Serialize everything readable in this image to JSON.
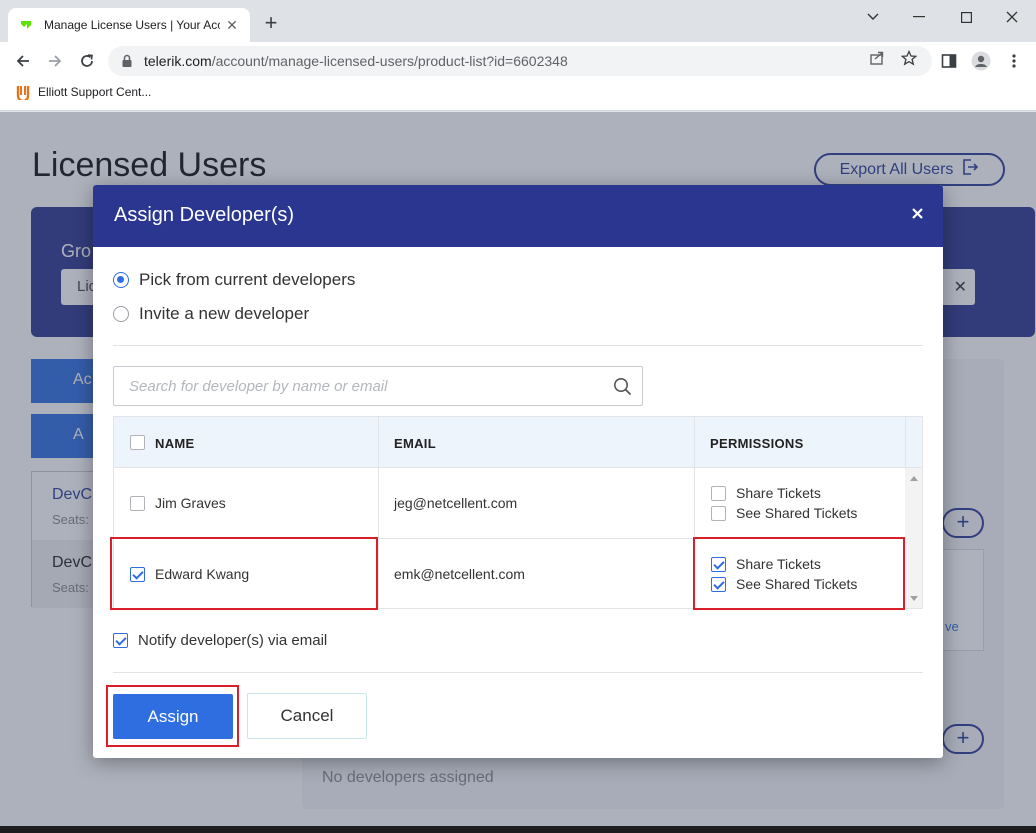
{
  "browser": {
    "tab_title": "Manage License Users | Your Account",
    "url_domain": "telerik.com",
    "url_path": "/account/manage-licensed-users/product-list?id=6602348",
    "bookmark_label": "Elliott Support Cent..."
  },
  "page": {
    "title": "Licensed Users",
    "export_label": "Export All Users",
    "group_label": "Gro",
    "group_field_value": "Lic",
    "side_btn_1": "Ac",
    "side_btn_2": "A",
    "list_item_1_name": "DevC",
    "list_item_1_sub": "Seats:",
    "list_item_2_name": "DevC",
    "list_item_2_sub": "Seats:",
    "remove_fragment": "ve",
    "no_developers": "No developers assigned"
  },
  "modal": {
    "title": "Assign Developer(s)",
    "radio_pick": "Pick from current developers",
    "radio_invite": "Invite a new developer",
    "search_placeholder": "Search for developer by name or email",
    "columns": {
      "name": "NAME",
      "email": "EMAIL",
      "permissions": "PERMISSIONS"
    },
    "rows": [
      {
        "name": "Jim Graves",
        "email": "jeg@netcellent.com",
        "selected": false,
        "share_tickets": false,
        "see_shared": false
      },
      {
        "name": "Edward Kwang",
        "email": "emk@netcellent.com",
        "selected": true,
        "share_tickets": true,
        "see_shared": true
      }
    ],
    "perm_share": "Share Tickets",
    "perm_see": "See Shared Tickets",
    "notify_label": "Notify developer(s) via email",
    "assign_label": "Assign",
    "cancel_label": "Cancel"
  },
  "colors": {
    "header_blue": "#2b3690",
    "accent_blue": "#2f6ee0",
    "highlight_red": "#d9202a"
  }
}
